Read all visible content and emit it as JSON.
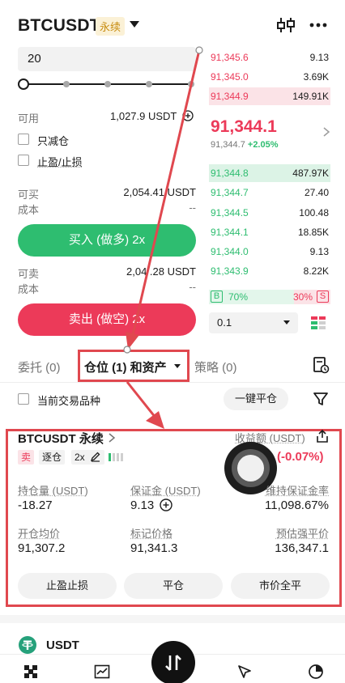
{
  "header": {
    "title": "BTCUSDT",
    "badge": "永续"
  },
  "order_form": {
    "quantity_value": "20",
    "available_label": "可用",
    "available_value": "1,027.9 USDT",
    "reduce_only_label": "只减仓",
    "tpsl_label": "止盈/止损",
    "can_buy_label": "可买",
    "can_buy_value": "2,054.41 USDT",
    "cost_label": "成本",
    "cost_value": "--",
    "buy_button": "买入 (做多) 2x",
    "can_sell_label": "可卖",
    "can_sell_value": "2,04 .28 USDT",
    "cost2_label": "成本",
    "cost2_value": "--",
    "sell_button": "卖出 (做空) 2x"
  },
  "order_book": {
    "asks": [
      {
        "price": "91,345.6",
        "qty": "9.13"
      },
      {
        "price": "91,345.0",
        "qty": "3.69K"
      },
      {
        "price": "91,344.9",
        "qty": "149.91K"
      }
    ],
    "last_price": "91,344.1",
    "mark_price": "91,344.7",
    "change": "+2.05%",
    "bids": [
      {
        "price": "91,344.8",
        "qty": "487.97K"
      },
      {
        "price": "91,344.7",
        "qty": "27.40"
      },
      {
        "price": "91,344.5",
        "qty": "100.48"
      },
      {
        "price": "91,344.1",
        "qty": "18.85K"
      },
      {
        "price": "91,344.0",
        "qty": "9.13"
      },
      {
        "price": "91,343.9",
        "qty": "8.22K"
      }
    ],
    "buy_ratio_label": "B",
    "buy_ratio": "70%",
    "sell_ratio": "30%",
    "sell_ratio_label": "S",
    "buy_ratio_fraction": 0.7,
    "depth_value": "0.1"
  },
  "tabs": [
    {
      "label": "委托 (0)"
    },
    {
      "label": "仓位 (1) 和资产"
    },
    {
      "label": "策略 (0)"
    }
  ],
  "filter": {
    "current_symbol_label": "当前交易品种",
    "close_all_button": "一键平仓"
  },
  "position": {
    "symbol": "BTCUSDT 永续",
    "pnl_label": "收益额 (USDT)",
    "pnl_value": "(-0.07%)",
    "side_tag": "卖",
    "margin_mode_tag": "逐仓",
    "leverage_tag": "2x",
    "size_label": "持仓量 (USDT)",
    "size_value": "-18.27",
    "margin_label": "保证金 (USDT)",
    "margin_value": "9.13",
    "maint_label": "维持保证金率",
    "maint_value": "11,098.67%",
    "entry_label": "开仓均价",
    "entry_value": "91,307.2",
    "mark_label": "标记价格",
    "mark_value": "91,341.3",
    "liq_label": "预估强平价",
    "liq_value": "136,347.1",
    "tpsl_button": "止盈止损",
    "close_button": "平仓",
    "market_close_button": "市价全平"
  },
  "asset": {
    "name": "USDT"
  },
  "colors": {
    "buy": "#2ebd70",
    "sell": "#ec3a59",
    "annotation": "#e0484f"
  }
}
